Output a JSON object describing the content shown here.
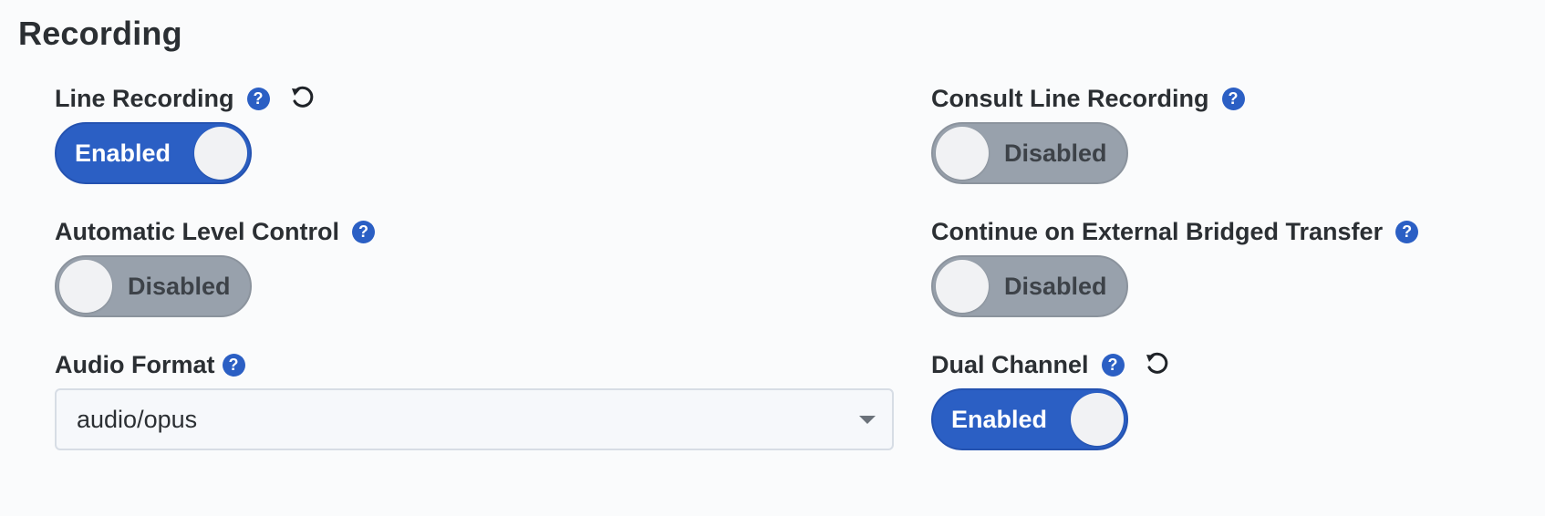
{
  "section": {
    "title": "Recording"
  },
  "fields": {
    "line_recording": {
      "label": "Line Recording",
      "help_icon": "?",
      "toggle_state": "Enabled",
      "has_reset": true
    },
    "consult_line_recording": {
      "label": "Consult Line Recording",
      "help_icon": "?",
      "toggle_state": "Disabled"
    },
    "automatic_level_control": {
      "label": "Automatic Level Control",
      "help_icon": "?",
      "toggle_state": "Disabled"
    },
    "continue_external_bridged_transfer": {
      "label": "Continue on External Bridged Transfer",
      "help_icon": "?",
      "toggle_state": "Disabled"
    },
    "audio_format": {
      "label": "Audio Format",
      "help_icon": "?",
      "selected_value": "audio/opus"
    },
    "dual_channel": {
      "label": "Dual Channel",
      "help_icon": "?",
      "toggle_state": "Enabled",
      "has_reset": true
    }
  },
  "icons": {
    "help": "question-circle-icon",
    "reset": "undo-icon",
    "dropdown": "caret-down-icon"
  },
  "colors": {
    "accent": "#2b5fc4",
    "toggle_off": "#98a1ac",
    "text": "#2b2f33",
    "background": "#fafbfc"
  }
}
